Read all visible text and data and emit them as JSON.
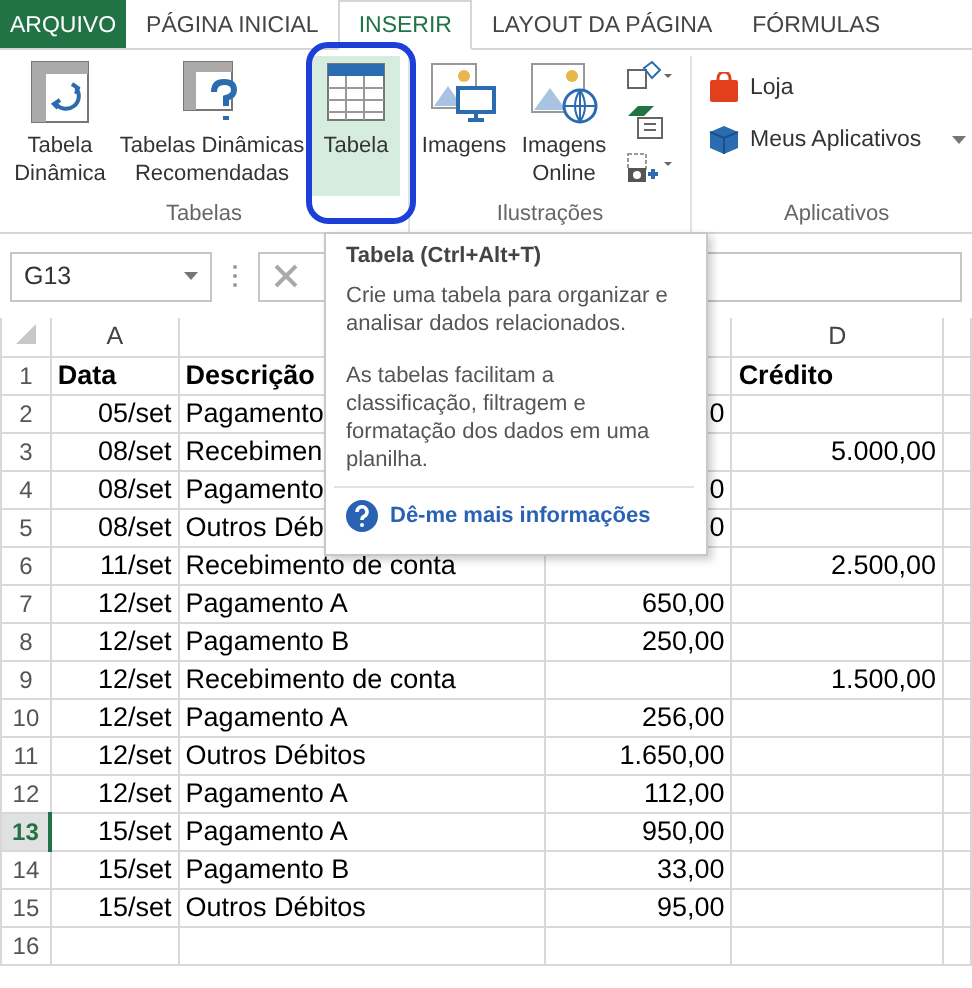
{
  "tabs": [
    {
      "label": "ARQUIVO",
      "kind": "file",
      "selected": false
    },
    {
      "label": "PÁGINA INICIAL",
      "kind": "tab",
      "selected": false
    },
    {
      "label": "INSERIR",
      "kind": "tab",
      "selected": true
    },
    {
      "label": "LAYOUT DA PÁGINA",
      "kind": "tab",
      "selected": false
    },
    {
      "label": "FÓRMULAS",
      "kind": "tab",
      "selected": false
    }
  ],
  "ribbon": {
    "groups": [
      {
        "label": "Tabelas",
        "items": [
          {
            "kind": "pivot",
            "label": "Tabela Dinâmica",
            "selected": false
          },
          {
            "kind": "recommended",
            "label": "Tabelas Dinâmicas Recomendadas",
            "selected": false
          },
          {
            "kind": "table",
            "label": "Tabela",
            "selected": true
          }
        ]
      },
      {
        "label": "Ilustrações",
        "items": [
          {
            "kind": "images",
            "label": "Imagens",
            "selected": false
          },
          {
            "kind": "online",
            "label": "Imagens Online",
            "selected": false
          },
          {
            "kind": "stack",
            "selected": false
          }
        ]
      },
      {
        "label": "Aplicativos",
        "items": [
          {
            "kind": "store",
            "label": "Loja",
            "selected": false
          },
          {
            "kind": "apps",
            "label": "Meus Aplicativos",
            "selected": false
          }
        ]
      }
    ]
  },
  "name_box": {
    "value": "G13"
  },
  "sheet": {
    "column_headers": {
      "column_1": "A",
      "column_4": "D"
    },
    "rows": [
      {
        "num": "1",
        "header": true,
        "selected": false,
        "cells": [
          "Data",
          "Descrição",
          null,
          "Crédito"
        ]
      },
      {
        "num": "2",
        "header": false,
        "selected": false,
        "cells": [
          "05/set",
          "Pagamento",
          "0",
          null
        ]
      },
      {
        "num": "3",
        "header": false,
        "selected": false,
        "cells": [
          "08/set",
          "Recebimen",
          null,
          "5.000,00"
        ]
      },
      {
        "num": "4",
        "header": false,
        "selected": false,
        "cells": [
          "08/set",
          "Pagamento",
          "0",
          null
        ]
      },
      {
        "num": "5",
        "header": false,
        "selected": false,
        "cells": [
          "08/set",
          "Outros Déb",
          "0",
          null
        ]
      },
      {
        "num": "6",
        "header": false,
        "selected": false,
        "cells": [
          "11/set",
          "Recebimento de conta",
          null,
          "2.500,00"
        ]
      },
      {
        "num": "7",
        "header": false,
        "selected": false,
        "cells": [
          "12/set",
          "Pagamento A",
          "650,00",
          null
        ]
      },
      {
        "num": "8",
        "header": false,
        "selected": false,
        "cells": [
          "12/set",
          "Pagamento B",
          "250,00",
          null
        ]
      },
      {
        "num": "9",
        "header": false,
        "selected": false,
        "cells": [
          "12/set",
          "Recebimento de conta",
          null,
          "1.500,00"
        ]
      },
      {
        "num": "10",
        "header": false,
        "selected": false,
        "cells": [
          "12/set",
          "Pagamento A",
          "256,00",
          null
        ]
      },
      {
        "num": "11",
        "header": false,
        "selected": false,
        "cells": [
          "12/set",
          "Outros Débitos",
          "1.650,00",
          null
        ]
      },
      {
        "num": "12",
        "header": false,
        "selected": false,
        "cells": [
          "12/set",
          "Pagamento A",
          "112,00",
          null
        ]
      },
      {
        "num": "13",
        "header": false,
        "selected": true,
        "cells": [
          "15/set",
          "Pagamento A",
          "950,00",
          null
        ]
      },
      {
        "num": "14",
        "header": false,
        "selected": false,
        "cells": [
          "15/set",
          "Pagamento B",
          "33,00",
          null
        ]
      },
      {
        "num": "15",
        "header": false,
        "selected": false,
        "cells": [
          "15/set",
          "Outros Débitos",
          "95,00",
          null
        ]
      },
      {
        "num": "16",
        "header": false,
        "selected": false,
        "cells": [
          null,
          null,
          null,
          null
        ]
      }
    ]
  },
  "tooltip": {
    "title": "Tabela (Ctrl+Alt+T)",
    "paragraphs": [
      "Crie uma tabela para organizar e analisar dados relacionados.",
      "As tabelas facilitam a classificação, filtragem e formatação dos dados em uma planilha."
    ],
    "link": "Dê-me mais informações"
  }
}
